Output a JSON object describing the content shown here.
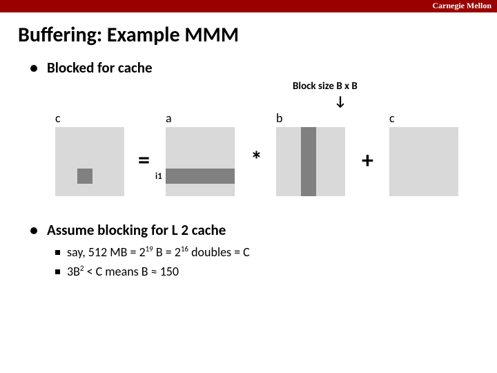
{
  "brand": "Carnegie Mellon",
  "title": "Buffering: Example MMM",
  "bullet1": "Blocked for cache",
  "blocksize": "Block size B x B",
  "matrices": {
    "c1": "c",
    "a": "a",
    "b": "b",
    "c2": "c"
  },
  "ops": {
    "eq": "=",
    "times": "*",
    "plus": "+"
  },
  "i1": "i1",
  "bullet2": "Assume blocking for L 2 cache",
  "sub1_pre": "say, 512 MB = 2",
  "sub1_exp1": "19",
  "sub1_mid": " B = 2",
  "sub1_exp2": "16",
  "sub1_post": " doubles = C",
  "sub2_pre": "3B",
  "sub2_exp": "2",
  "sub2_post": " < C means B ≈ 150"
}
